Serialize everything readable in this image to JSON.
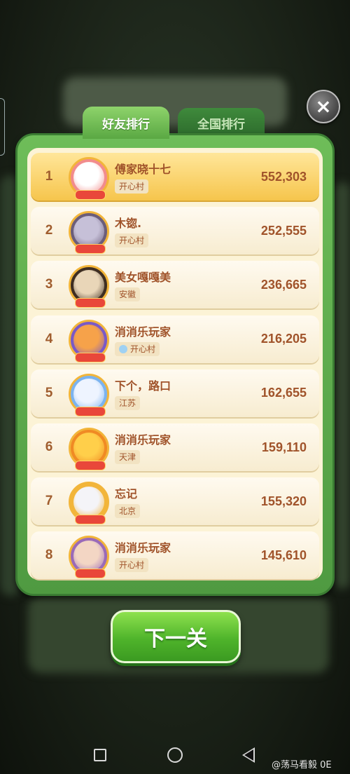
{
  "tabs": {
    "friends": "好友排行",
    "national": "全国排行"
  },
  "close_icon": "×",
  "leaderboard": [
    {
      "rank": "1",
      "name": "傅家晓十七",
      "location": "开心村",
      "score": "552,303",
      "avatar_colors": [
        "#ffffff",
        "#f28c8c"
      ],
      "highlight": true
    },
    {
      "rank": "2",
      "name": "木锪.",
      "location": "开心村",
      "score": "252,555",
      "avatar_colors": [
        "#c6c0d8",
        "#6b5d7a"
      ],
      "highlight": false
    },
    {
      "rank": "3",
      "name": "美女嘎嘎美",
      "location": "安徽",
      "score": "236,665",
      "avatar_colors": [
        "#e9d6b8",
        "#3e2e22"
      ],
      "highlight": false
    },
    {
      "rank": "4",
      "name": "消消乐玩家",
      "location": "开心村",
      "score": "216,205",
      "avatar_colors": [
        "#f6a24a",
        "#7a59c7"
      ],
      "highlight": false,
      "has_icon": true
    },
    {
      "rank": "5",
      "name": "下个，路口",
      "location": "江苏",
      "score": "162,655",
      "avatar_colors": [
        "#eef4ff",
        "#7bb3ef"
      ],
      "highlight": false
    },
    {
      "rank": "6",
      "name": "消消乐玩家",
      "location": "天津",
      "score": "159,110",
      "avatar_colors": [
        "#ffcf4a",
        "#f08a24"
      ],
      "highlight": false
    },
    {
      "rank": "7",
      "name": "忘记",
      "location": "北京",
      "score": "155,320",
      "avatar_colors": [
        "#f4f4f8",
        "#f2b53a"
      ],
      "highlight": false
    },
    {
      "rank": "8",
      "name": "消消乐玩家",
      "location": "开心村",
      "score": "145,610",
      "avatar_colors": [
        "#f3d6c4",
        "#9a6ab8"
      ],
      "highlight": false
    }
  ],
  "next_button": "下一关",
  "watermark": "@荡马看毅 0E",
  "colors": {
    "panel_green": "#5aa843",
    "row_cream": "#fcf3d6",
    "text_brown": "#a0532a",
    "button_green": "#4fb42b"
  }
}
